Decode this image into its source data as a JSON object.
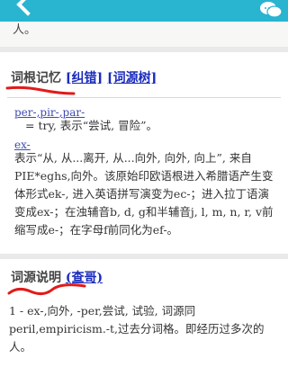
{
  "header": {
    "back_icon": "back-arrow-icon",
    "chat_icon": "chat-bubble-icon"
  },
  "top_snippet": "人。",
  "etymology_memory": {
    "title": "词根记忆",
    "links": [
      "[纠错]",
      "[词源树]"
    ],
    "root1": "per-,pir-,par-",
    "root1_text": "= try, 表示“尝试, 冒险”。",
    "root2": "ex-",
    "root2_text": "表示“从, 从...离开, 从...向外, 向外, 向上”, 来自PIE*eghs,向外。该原始印欧语根进入希腊语产生变体形式ek-, 进入英语拼写演变为ec-；进入拉丁语演变成ex-；在浊辅音b, d, g和半辅音j, l, m, n, r, v前缩写成e-；在字母f前同化为ef-。"
  },
  "etymology_explanation": {
    "title": "词源说明",
    "link": "(查哥)",
    "text": "1 - ex-,向外, -per,尝试, 试验, 词源同peril,empiricism.-t,过去分词格。即经历过多次的人。"
  },
  "colors": {
    "accent": "#29b4cf",
    "link": "#1a2bbd",
    "annotation": "#e21a1a"
  }
}
